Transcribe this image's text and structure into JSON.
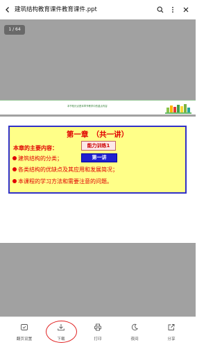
{
  "header": {
    "title": "建筑结构教育课件教育课件.ppt",
    "back_icon": "back-arrow-icon",
    "search_icon": "search-icon",
    "more_icon": "more-vertical-icon",
    "close_icon": "close-icon"
  },
  "viewer": {
    "page_indicator": "1 / 64",
    "prev_slide_footer": "本节知识点是本章节教学中的重点内容"
  },
  "slide": {
    "chapter_title": "第一章　（共一讲）",
    "content_heading": "本章的主要内容：",
    "bullets": [
      "建筑结构的分类；",
      "各类结构的优缺点及其应用和发展简况；",
      "本课程的学习方法和需要注意的问题。"
    ],
    "training_button": "能力训练1",
    "lecture_button": "第一讲"
  },
  "toolbar": {
    "items": [
      {
        "label": "翻页设置",
        "icon": "page-settings-icon"
      },
      {
        "label": "下载",
        "icon": "download-icon"
      },
      {
        "label": "打印",
        "icon": "print-icon"
      },
      {
        "label": "夜间",
        "icon": "night-mode-icon"
      },
      {
        "label": "分享",
        "icon": "share-icon"
      }
    ],
    "highlighted": "下载"
  },
  "colors": {
    "viewer_bg": "#a1a1a1",
    "title_box_fill": "#ffff88",
    "title_box_border": "#3030c8",
    "slide_text_red": "#e00000",
    "lecture_button_blue": "#2020d0",
    "highlight_red": "#e02020"
  }
}
